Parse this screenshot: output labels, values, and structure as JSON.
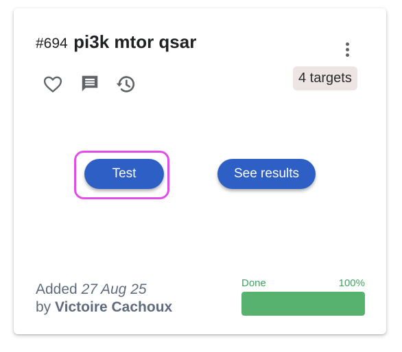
{
  "card": {
    "number": "#694",
    "title": "pi3k mtor qsar",
    "targets_badge": "4 targets",
    "icons": [
      "heart-outline",
      "comment",
      "history",
      "more-vertical"
    ],
    "actions": {
      "test_label": "Test",
      "results_label": "See results"
    },
    "footer": {
      "added_prefix": "Added",
      "added_date": "27 Aug 25",
      "by_prefix": "by",
      "author": "Victoire Cachoux"
    },
    "progress": {
      "status": "Done",
      "percent_label": "100%",
      "value": 1.0
    },
    "colors": {
      "primary_button": "#2d5fc4",
      "highlight_outline": "#e24de8",
      "progress": "#57b26f",
      "progress_text": "#3ca55c",
      "badge_bg": "#ede4e4"
    }
  }
}
